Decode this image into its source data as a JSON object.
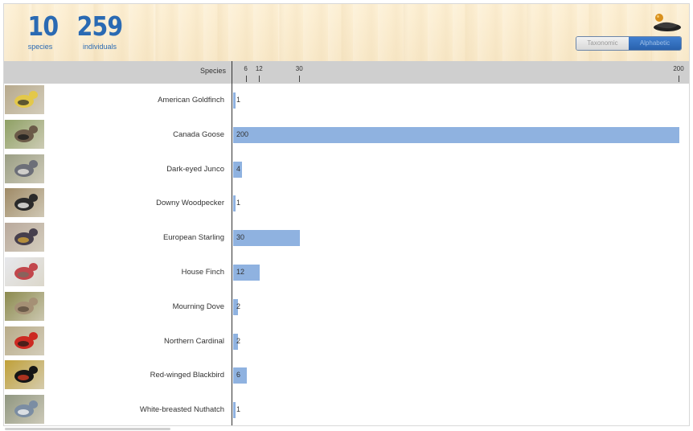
{
  "summary": {
    "species_count": "10",
    "species_label": "species",
    "individuals_count": "259",
    "individuals_label": "individuals"
  },
  "sort_toggle": {
    "options": [
      "Taxonomic",
      "Alphabetic"
    ],
    "selected": "Alphabetic"
  },
  "column_header": {
    "species": "Species"
  },
  "colors": {
    "accent": "#2a6ab3",
    "bar": "#8fb2e0",
    "header_gray": "#cfcfcf",
    "toggle_on": "#2f6cbd"
  },
  "chart_data": {
    "type": "bar",
    "orientation": "horizontal",
    "axis_ticks": [
      6,
      12,
      30,
      200
    ],
    "axis_tick_labels": [
      "6",
      "12",
      "30",
      "200"
    ],
    "xlim": [
      0,
      200
    ],
    "categories": [
      "American Goldfinch",
      "Canada Goose",
      "Dark-eyed Junco",
      "Downy Woodpecker",
      "European Starling",
      "House Finch",
      "Mourning Dove",
      "Northern Cardinal",
      "Red-winged Blackbird",
      "White-breasted Nuthatch"
    ],
    "values": [
      1,
      200,
      4,
      1,
      30,
      12,
      2,
      2,
      6,
      1
    ],
    "value_labels": [
      "1",
      "200",
      "4",
      "1",
      "30",
      "12",
      "2",
      "2",
      "6",
      "1"
    ]
  },
  "photos": [
    {
      "bg": "#b7a98c",
      "bird": "#e3c84a",
      "accent": "#3a3a2a"
    },
    {
      "bg": "#8ea064",
      "bird": "#6b5a48",
      "accent": "#1d1d1d"
    },
    {
      "bg": "#9a9e84",
      "bird": "#6c6f78",
      "accent": "#e8e6df"
    },
    {
      "bg": "#9f8a66",
      "bird": "#2a2a2a",
      "accent": "#f1f0ec"
    },
    {
      "bg": "#b9a99c",
      "bird": "#463f4d",
      "accent": "#cfa33a"
    },
    {
      "bg": "#e7e8ec",
      "bird": "#c2474c",
      "accent": "#7a6a60"
    },
    {
      "bg": "#8b8a4e",
      "bird": "#a59075",
      "accent": "#5d4e3e"
    },
    {
      "bg": "#b8ab88",
      "bird": "#cc2a22",
      "accent": "#2b1b18"
    },
    {
      "bg": "#c0a038",
      "bird": "#151515",
      "accent": "#d23a22"
    },
    {
      "bg": "#8f9680",
      "bird": "#7b8da3",
      "accent": "#f3f3f3"
    }
  ]
}
